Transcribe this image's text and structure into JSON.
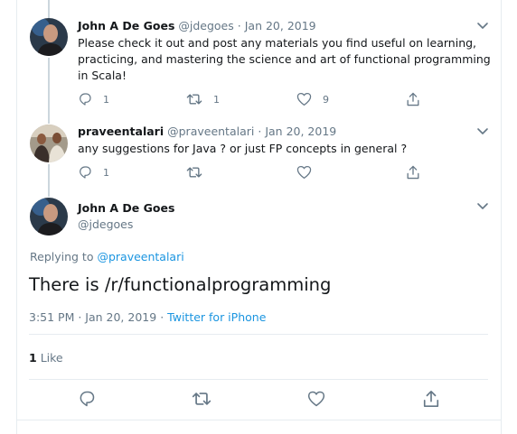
{
  "tweets": [
    {
      "name": "John A De Goes",
      "handle": "@jdegoes",
      "sep": "·",
      "date": "Jan 20, 2019",
      "text": "Please check it out and post any materials you find useful on learning, practicing, and mastering the science and art of functional programming in Scala!",
      "reply_count": "1",
      "retweet_count": "1",
      "like_count": "9"
    },
    {
      "name": "praveentalari",
      "handle": "@praveentalari",
      "sep": "·",
      "date": "Jan 20, 2019",
      "text": "any suggestions for Java ? or just FP concepts in general ?",
      "reply_count": "1",
      "retweet_count": "",
      "like_count": ""
    }
  ],
  "main": {
    "name": "John A De Goes",
    "handle": "@jdegoes",
    "replying_prefix": "Replying to",
    "replying_to": "@praveentalari",
    "text": "There is /r/functionalprogramming",
    "time": "3:51 PM · Jan 20, 2019",
    "sep": "·",
    "source": "Twitter for iPhone",
    "like_count": "1",
    "like_label": "Like"
  },
  "icons": {
    "reply": "reply-icon",
    "retweet": "retweet-icon",
    "like": "heart-icon",
    "share": "share-icon",
    "more": "chevron-down-icon"
  },
  "colors": {
    "link": "#1b95e0",
    "muted": "#657786",
    "text": "#14171a",
    "border": "#e6ecf0"
  }
}
